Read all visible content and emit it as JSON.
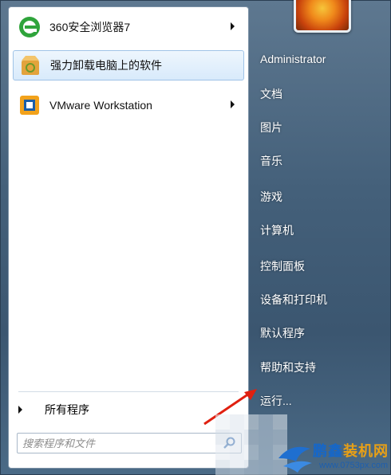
{
  "start_menu": {
    "pinned_programs": [
      {
        "label": "360安全浏览器7",
        "icon": "ie-360-browser-icon",
        "has_submenu": true,
        "highlighted": false
      },
      {
        "label": "强力卸载电脑上的软件",
        "icon": "uninstall-box-icon",
        "has_submenu": false,
        "highlighted": true
      },
      {
        "label": "VMware Workstation",
        "icon": "vmware-icon",
        "has_submenu": true,
        "highlighted": false
      }
    ],
    "all_programs_label": "所有程序",
    "search": {
      "placeholder": "搜索程序和文件",
      "value": ""
    },
    "right_panel": {
      "user_name": "Administrator",
      "items": [
        "文档",
        "图片",
        "音乐",
        "游戏",
        "计算机",
        "控制面板",
        "设备和打印机",
        "默认程序",
        "帮助和支持",
        "运行..."
      ]
    }
  },
  "annotation": {
    "arrow_color": "#e02010",
    "points_to": "运行..."
  },
  "watermark": {
    "brand_prefix": "鹏鑫",
    "brand_suffix": "装机网",
    "url": "www.0753px.com"
  },
  "colors": {
    "panel_bg": "#4a6680",
    "highlight": "#d8eafb",
    "text_white": "#ffffff"
  }
}
